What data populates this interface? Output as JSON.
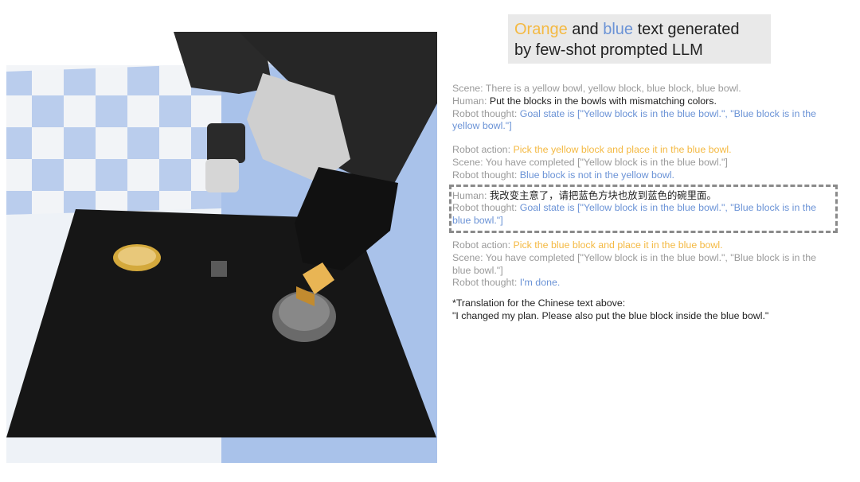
{
  "header": {
    "orange_word": "Orange",
    "and_text": " and ",
    "blue_word": "blue",
    "line1_rest": " text generated",
    "line2": "by few-shot prompted LLM"
  },
  "dialog": {
    "scene1_label": "Scene:",
    "scene1_text": " There is a yellow bowl, yellow block, blue block, blue bowl.",
    "human1_label": "Human:",
    "human1_text": " Put the blocks in the bowls with mismatching colors.",
    "thought1_label": "Robot thought:",
    "thought1_text": " Goal state is [\"Yellow block is in the blue bowl.\", \"Blue block is in the yellow bowl.\"]",
    "action1_label": "Robot action:",
    "action1_text": " Pick the yellow block and place it in the blue bowl.",
    "scene2_label": "Scene:",
    "scene2_text": " You have completed [\"Yellow block is in the blue bowl.\"]",
    "thought2_label": "Robot thought:",
    "thought2_text": " Blue block is not in the yellow bowl.",
    "human2_label": "Human:",
    "human2_text": " 我改变主意了，请把蓝色方块也放到蓝色的碗里面。",
    "thought3_label": "Robot thought:",
    "thought3_text": " Goal state is [\"Yellow block is in the blue bowl.\", \"Blue block is in the blue bowl.\"]",
    "action2_label": "Robot action:",
    "action2_text": " Pick the blue block and place it in the blue bowl.",
    "scene3_label": "Scene:",
    "scene3_text": " You have completed [\"Yellow block is in the blue bowl.\", \"Blue block is in the blue bowl.\"]",
    "thought4_label": "Robot thought:",
    "thought4_text": " I'm done.",
    "translation_label": "*Translation for the Chinese text above:",
    "translation_text": "\"I changed my plan. Please also put the blue block inside the blue bowl.\""
  },
  "colors": {
    "orange": "#f4b942",
    "blue": "#6b93d6",
    "floor_blue": "#a9c2ea",
    "table": "#161616"
  }
}
